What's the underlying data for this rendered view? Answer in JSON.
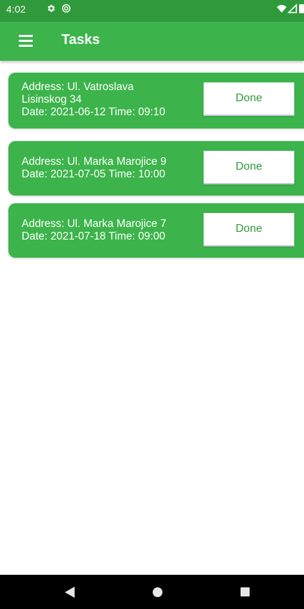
{
  "status_bar": {
    "time": "4:02",
    "icons": [
      "gear-icon",
      "sync-icon",
      "wifi-icon",
      "signal-icon",
      "battery-icon"
    ]
  },
  "app_bar": {
    "title": "Tasks",
    "menu_icon": "hamburger-menu-icon"
  },
  "tasks": [
    {
      "address_lines": [
        "Address: Ul. Vatroslava",
        "Lisinskog 34"
      ],
      "datetime": "Date: 2021-06-12 Time: 09:10",
      "button_label": "Done"
    },
    {
      "address_lines": [
        "Address: Ul. Marka Marojice 9"
      ],
      "datetime": "Date: 2021-07-05 Time: 10:00",
      "button_label": "Done"
    },
    {
      "address_lines": [
        "Address: Ul. Marka Marojice 7"
      ],
      "datetime": "Date: 2021-07-18 Time: 09:00",
      "button_label": "Done"
    }
  ],
  "nav_bar": {
    "icons": [
      "back-icon",
      "home-icon",
      "recents-icon"
    ]
  },
  "colors": {
    "primary": "#3cb44b",
    "primary_dark": "#2f9a3b",
    "button_background": "#ffffff",
    "button_text": "#2f9a3b"
  }
}
